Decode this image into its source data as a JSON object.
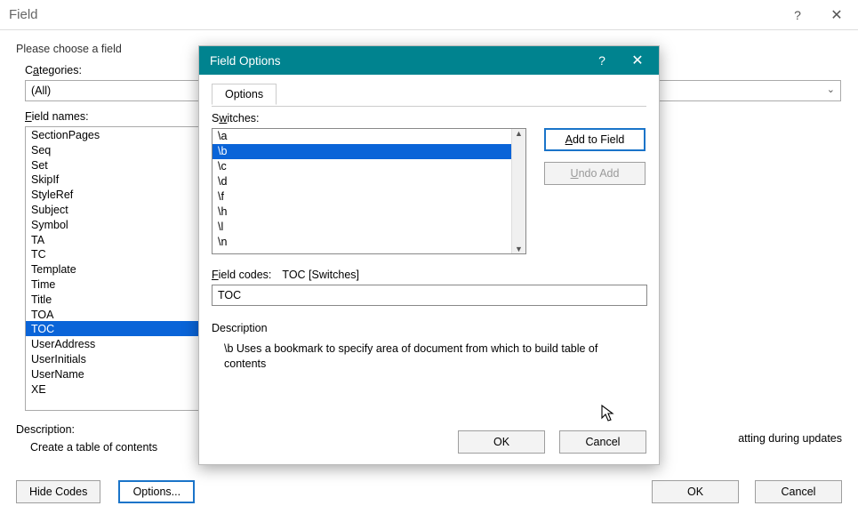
{
  "field": {
    "title": "Field",
    "choose": "Please choose a field",
    "categoriesLabelPre": "C",
    "categoriesLabelAccel": "a",
    "categoriesLabelPost": "tegories:",
    "categoryValue": "(All)",
    "namesLabelPre": "",
    "namesLabelAccel": "F",
    "namesLabelPost": "ield names:",
    "items": [
      "SectionPages",
      "Seq",
      "Set",
      "SkipIf",
      "StyleRef",
      "Subject",
      "Symbol",
      "TA",
      "TC",
      "Template",
      "Time",
      "Title",
      "TOA",
      "TOC",
      "UserAddress",
      "UserInitials",
      "UserName",
      "XE"
    ],
    "selectedIndex": 13,
    "preserve": "atting during updates",
    "descLabel": "Description:",
    "descText": "Create a table of contents",
    "hideCodes": "Hide Codes",
    "options": "Options...",
    "ok": "OK",
    "cancel": "Cancel"
  },
  "modal": {
    "title": "Field Options",
    "tab": "Options",
    "switchesLabelPre": "S",
    "switchesLabelAccel": "w",
    "switchesLabelPost": "itches:",
    "switches": [
      "\\a",
      "\\b",
      "\\c",
      "\\d",
      "\\f",
      "\\h",
      "\\l",
      "\\n"
    ],
    "switchSelected": 1,
    "addLabelPre": "",
    "addLabelAccel": "A",
    "addLabelPost": "dd to Field",
    "undoLabelPre": "",
    "undoLabelAccel": "U",
    "undoLabelPost": "ndo Add",
    "fcLabelPre": "",
    "fcLabelAccel": "F",
    "fcLabelPost": "ield codes:",
    "fcFormat": "TOC [Switches]",
    "fcValue": "TOC",
    "descLabel": "Description",
    "descText": "\\b Uses a bookmark to specify area of document from which to build table of contents",
    "ok": "OK",
    "cancel": "Cancel"
  }
}
